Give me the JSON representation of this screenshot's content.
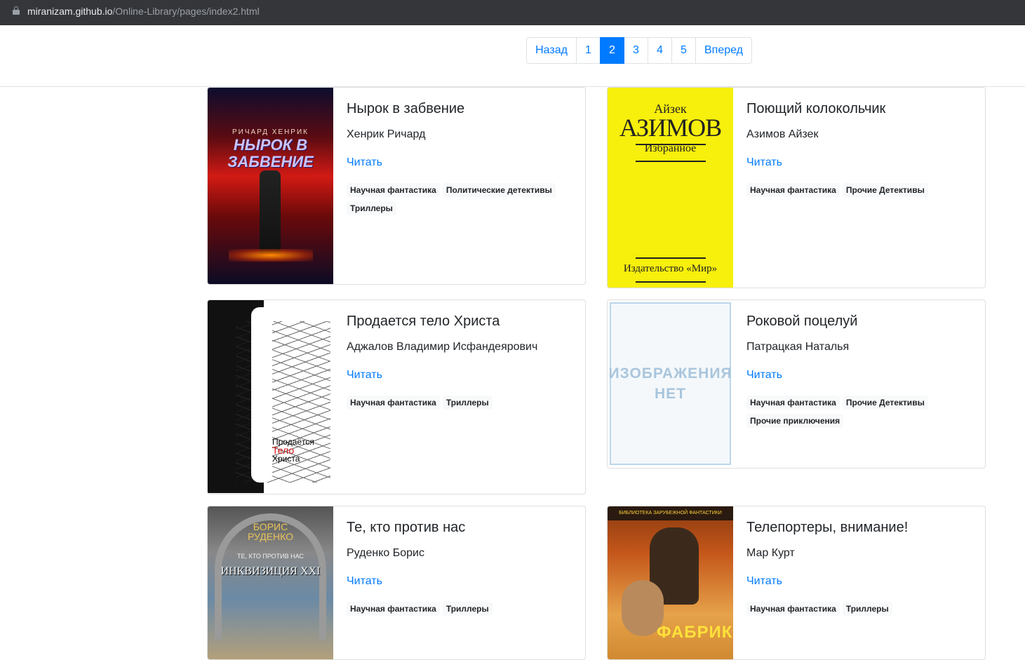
{
  "browser": {
    "url_host": "miranizam.github.io",
    "url_path": "/Online-Library/pages/index2.html"
  },
  "pagination": {
    "prev": "Назад",
    "pages": [
      "1",
      "2",
      "3",
      "4",
      "5"
    ],
    "active_page": "2",
    "next": "Вперед"
  },
  "read_label": "Читать",
  "books": [
    {
      "title": "Нырок в забвение",
      "author": "Хенрик Ричард",
      "tags": [
        "Научная фантастика",
        "Политические детективы",
        "Триллеры"
      ],
      "cover": {
        "line1": "РИЧАРД ХЕНРИК",
        "line2": "НЫРОК В ЗАБВЕНИЕ"
      }
    },
    {
      "title": "Поющий колокольчик",
      "author": "Азимов Айзек",
      "tags": [
        "Научная фантастика",
        "Прочие Детективы"
      ],
      "cover": {
        "line1": "Айзек",
        "line2": "АЗИМОВ",
        "line3": "Избранное",
        "line4": "Издательство «Мир»"
      }
    },
    {
      "title": "Продается тело Христа",
      "author": "Аджалов Владимир Исфандеярович",
      "tags": [
        "Научная фантастика",
        "Триллеры"
      ],
      "cover": {
        "line1": "Продаётся",
        "line2": "Тело",
        "line3": "Христа"
      }
    },
    {
      "title": "Роковой поцелуй",
      "author": "Патрацкая Наталья",
      "tags": [
        "Научная фантастика",
        "Прочие Детективы",
        "Прочие приключения"
      ],
      "cover": {
        "line1": "ИЗОБРАЖЕНИЯ",
        "line2": "НЕТ"
      }
    },
    {
      "title": "Те, кто против нас",
      "author": "Руденко Борис",
      "tags": [
        "Научная фантастика",
        "Триллеры"
      ],
      "cover": {
        "line1": "БОРИС",
        "line2": "РУДЕНКО",
        "line3": "ТЕ, КТО ПРОТИВ НАС",
        "line4": "ИНКВИЗИЦИЯ XXI"
      }
    },
    {
      "title": "Телепортеры, внимание!",
      "author": "Мар Курт",
      "tags": [
        "Научная фантастика",
        "Триллеры"
      ],
      "cover": {
        "line1": "БИБЛИОТЕКА ЗАРУБЕЖНОЙ ФАНТАСТИКИ",
        "line2": "ФАБРИКА"
      }
    }
  ]
}
